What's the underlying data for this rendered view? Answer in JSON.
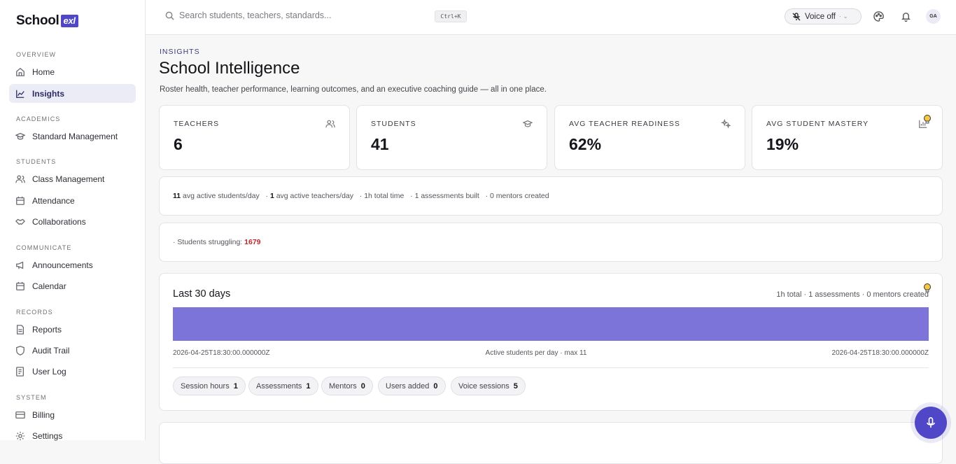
{
  "brand": {
    "name": "School",
    "badge": "exl"
  },
  "sidebar": {
    "sections": [
      "OVERVIEW",
      "ACADEMICS",
      "STUDENTS",
      "COMMUNICATE",
      "RECORDS",
      "SYSTEM"
    ],
    "items": [
      {
        "label": "Home",
        "icon": "home-icon"
      },
      {
        "label": "Insights",
        "icon": "chart-icon"
      },
      {
        "label": "Standard Management",
        "icon": "graduation-cap-icon"
      },
      {
        "label": "Class Management",
        "icon": "users-icon"
      },
      {
        "label": "Attendance",
        "icon": "calendar-icon"
      },
      {
        "label": "Collaborations",
        "icon": "handshake-icon"
      },
      {
        "label": "Announcements",
        "icon": "megaphone-icon"
      },
      {
        "label": "Calendar",
        "icon": "calendar-icon"
      },
      {
        "label": "Reports",
        "icon": "file-icon"
      },
      {
        "label": "Audit Trail",
        "icon": "shield-icon"
      },
      {
        "label": "User Log",
        "icon": "log-icon"
      },
      {
        "label": "Billing",
        "icon": "credit-card-icon"
      },
      {
        "label": "Settings",
        "icon": "gear-icon"
      }
    ]
  },
  "topbar": {
    "search_placeholder": "Search students, teachers, standards...",
    "shortcut": "Ctrl+K",
    "voice": "Voice off",
    "avatar": "GA"
  },
  "page": {
    "eyebrow": "INSIGHTS",
    "title": "School Intelligence",
    "subtitle": "Roster health, teacher performance, learning outcomes, and an executive coaching guide — all in one place."
  },
  "stats": [
    {
      "label": "TEACHERS",
      "value": "6"
    },
    {
      "label": "STUDENTS",
      "value": "41"
    },
    {
      "label": "AVG TEACHER READINESS",
      "value": "62%"
    },
    {
      "label": "AVG STUDENT MASTERY",
      "value": "19%"
    }
  ],
  "activity": {
    "students_n": "11",
    "students_t": "avg active students/day",
    "teachers_n": "1",
    "teachers_t": "avg active teachers/day",
    "time": "· 1h total time",
    "assess": "· 1 assessments built",
    "mentors": "· 0 mentors created"
  },
  "struggle": {
    "label": "· Students struggling:",
    "value": "1679"
  },
  "last30": {
    "title": "Last 30 days",
    "summary": "1h total · 1 assessments · 0 mentors created",
    "start": "2026-04-25T18:30:00.000000Z",
    "end": "2026-04-25T18:30:00.000000Z",
    "caption": "Active students per day · max 11"
  },
  "pills": [
    {
      "label": "Session hours",
      "value": "1"
    },
    {
      "label": "Assessments",
      "value": "1"
    },
    {
      "label": "Mentors",
      "value": "0"
    },
    {
      "label": "Users added",
      "value": "0"
    },
    {
      "label": "Voice sessions",
      "value": "5"
    }
  ],
  "colors": {
    "accent": "#4f46c8",
    "bar": "#7c74d8",
    "danger": "#c0262d"
  }
}
